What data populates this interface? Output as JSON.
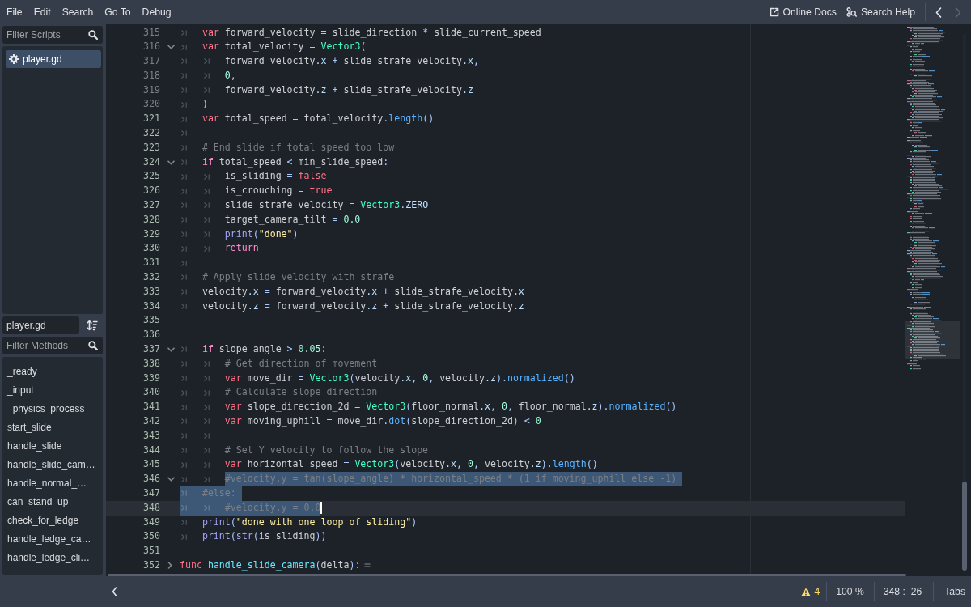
{
  "menu_bar": {
    "menus": [
      "File",
      "Edit",
      "Search",
      "Go To",
      "Debug"
    ],
    "links": [
      {
        "kind": "external",
        "label": "Online Docs"
      },
      {
        "kind": "help",
        "label": "Search Help"
      }
    ],
    "history": [
      {
        "kind": "back",
        "disabled": false
      },
      {
        "kind": "forward",
        "disabled": true
      }
    ]
  },
  "scripts_panel": {
    "filter": {
      "placeholder": "Filter Scripts"
    },
    "items": [
      {
        "label": "player.gd",
        "selected": true
      }
    ]
  },
  "methods_panel": {
    "script_name": "player.gd",
    "filter": {
      "placeholder": "Filter Methods"
    },
    "items": [
      {
        "label": "_ready",
        "selected": false
      },
      {
        "label": "_input",
        "selected": false
      },
      {
        "label": "_physics_process",
        "selected": false
      },
      {
        "label": "start_slide",
        "selected": false
      },
      {
        "label": "handle_slide",
        "selected": false
      },
      {
        "label": "handle_slide_cam…",
        "selected": false
      },
      {
        "label": "handle_normal_…",
        "selected": false
      },
      {
        "label": "can_stand_up",
        "selected": false
      },
      {
        "label": "check_for_ledge",
        "selected": false
      },
      {
        "label": "handle_ledge_ca…",
        "selected": false
      },
      {
        "label": "handle_ledge_cli…",
        "selected": false
      }
    ]
  },
  "editor": {
    "lines": [
      {
        "number": "315",
        "type_safe": false,
        "current": false,
        "tokens": [
          {
            "kind": "tab"
          },
          {
            "kind": "keyword",
            "text": "var"
          },
          {
            "kind": "plain",
            "text": " forward_velocity"
          },
          {
            "kind": "symbol",
            "text": " = "
          },
          {
            "kind": "plain",
            "text": "slide_direction"
          },
          {
            "kind": "symbol",
            "text": " * "
          },
          {
            "kind": "plain",
            "text": "slide_current_speed"
          }
        ]
      },
      {
        "number": "316",
        "type_safe": false,
        "current": false,
        "expanded": true,
        "tokens": [
          {
            "kind": "tab"
          },
          {
            "kind": "keyword",
            "text": "var"
          },
          {
            "kind": "plain",
            "text": " total_velocity"
          },
          {
            "kind": "symbol",
            "text": " = "
          },
          {
            "kind": "type",
            "text": "Vector3"
          },
          {
            "kind": "symbol",
            "text": "("
          }
        ]
      },
      {
        "number": "317",
        "type_safe": false,
        "current": false,
        "tokens": [
          {
            "kind": "tab"
          },
          {
            "kind": "tab"
          },
          {
            "kind": "plain",
            "text": "forward_velocity"
          },
          {
            "kind": "member",
            "text": ".x"
          },
          {
            "kind": "symbol",
            "text": " + "
          },
          {
            "kind": "plain",
            "text": "slide_strafe_velocity"
          },
          {
            "kind": "member",
            "text": ".x"
          },
          {
            "kind": "symbol",
            "text": ","
          }
        ]
      },
      {
        "number": "318",
        "type_safe": false,
        "current": false,
        "tokens": [
          {
            "kind": "tab"
          },
          {
            "kind": "tab"
          },
          {
            "kind": "number",
            "text": "0"
          },
          {
            "kind": "symbol",
            "text": ","
          }
        ]
      },
      {
        "number": "319",
        "type_safe": false,
        "current": false,
        "tokens": [
          {
            "kind": "tab"
          },
          {
            "kind": "tab"
          },
          {
            "kind": "plain",
            "text": "forward_velocity"
          },
          {
            "kind": "member",
            "text": ".z"
          },
          {
            "kind": "symbol",
            "text": " + "
          },
          {
            "kind": "plain",
            "text": "slide_strafe_velocity"
          },
          {
            "kind": "member",
            "text": ".z"
          }
        ]
      },
      {
        "number": "320",
        "type_safe": false,
        "current": false,
        "tokens": [
          {
            "kind": "tab"
          },
          {
            "kind": "symbol",
            "text": ")"
          }
        ]
      },
      {
        "number": "321",
        "type_safe": true,
        "current": false,
        "tokens": [
          {
            "kind": "tab"
          },
          {
            "kind": "keyword",
            "text": "var"
          },
          {
            "kind": "plain",
            "text": " total_speed"
          },
          {
            "kind": "symbol",
            "text": " = "
          },
          {
            "kind": "plain",
            "text": "total_velocity"
          },
          {
            "kind": "symbol",
            "text": "."
          },
          {
            "kind": "method",
            "text": "length"
          },
          {
            "kind": "symbol",
            "text": "()"
          }
        ]
      },
      {
        "number": "322",
        "type_safe": true,
        "current": false,
        "tokens": [
          {
            "kind": "tab"
          }
        ]
      },
      {
        "number": "323",
        "type_safe": true,
        "current": false,
        "tokens": [
          {
            "kind": "tab"
          },
          {
            "kind": "comment",
            "text": "# End slide if total speed too low"
          }
        ]
      },
      {
        "number": "324",
        "type_safe": true,
        "current": false,
        "expanded": true,
        "tokens": [
          {
            "kind": "tab"
          },
          {
            "kind": "control",
            "text": "if"
          },
          {
            "kind": "plain",
            "text": " total_speed"
          },
          {
            "kind": "symbol",
            "text": " < "
          },
          {
            "kind": "plain",
            "text": "min_slide_speed"
          },
          {
            "kind": "symbol",
            "text": ":"
          }
        ]
      },
      {
        "number": "325",
        "type_safe": true,
        "current": false,
        "tokens": [
          {
            "kind": "tab"
          },
          {
            "kind": "tab"
          },
          {
            "kind": "plain",
            "text": "is_sliding"
          },
          {
            "kind": "symbol",
            "text": " = "
          },
          {
            "kind": "keyword",
            "text": "false"
          }
        ]
      },
      {
        "number": "326",
        "type_safe": true,
        "current": false,
        "tokens": [
          {
            "kind": "tab"
          },
          {
            "kind": "tab"
          },
          {
            "kind": "plain",
            "text": "is_crouching"
          },
          {
            "kind": "symbol",
            "text": " = "
          },
          {
            "kind": "keyword",
            "text": "true"
          }
        ]
      },
      {
        "number": "327",
        "type_safe": true,
        "current": false,
        "tokens": [
          {
            "kind": "tab"
          },
          {
            "kind": "tab"
          },
          {
            "kind": "plain",
            "text": "slide_strafe_velocity"
          },
          {
            "kind": "symbol",
            "text": " = "
          },
          {
            "kind": "type",
            "text": "Vector3"
          },
          {
            "kind": "symbol",
            "text": "."
          },
          {
            "kind": "member",
            "text": "ZERO"
          }
        ]
      },
      {
        "number": "328",
        "type_safe": true,
        "current": false,
        "tokens": [
          {
            "kind": "tab"
          },
          {
            "kind": "tab"
          },
          {
            "kind": "plain",
            "text": "target_camera_tilt"
          },
          {
            "kind": "symbol",
            "text": " = "
          },
          {
            "kind": "number",
            "text": "0.0"
          }
        ]
      },
      {
        "number": "329",
        "type_safe": true,
        "current": false,
        "tokens": [
          {
            "kind": "tab"
          },
          {
            "kind": "tab"
          },
          {
            "kind": "builtin",
            "text": "print"
          },
          {
            "kind": "symbol",
            "text": "("
          },
          {
            "kind": "string",
            "text": "\"done\""
          },
          {
            "kind": "symbol",
            "text": ")"
          }
        ]
      },
      {
        "number": "330",
        "type_safe": true,
        "current": false,
        "tokens": [
          {
            "kind": "tab"
          },
          {
            "kind": "tab"
          },
          {
            "kind": "control",
            "text": "return"
          }
        ]
      },
      {
        "number": "331",
        "type_safe": true,
        "current": false,
        "tokens": [
          {
            "kind": "tab"
          }
        ]
      },
      {
        "number": "332",
        "type_safe": true,
        "current": false,
        "tokens": [
          {
            "kind": "tab"
          },
          {
            "kind": "comment",
            "text": "# Apply slide velocity with strafe"
          }
        ]
      },
      {
        "number": "333",
        "type_safe": true,
        "current": false,
        "tokens": [
          {
            "kind": "tab"
          },
          {
            "kind": "plain",
            "text": "velocity"
          },
          {
            "kind": "member",
            "text": ".x"
          },
          {
            "kind": "symbol",
            "text": " = "
          },
          {
            "kind": "plain",
            "text": "forward_velocity"
          },
          {
            "kind": "member",
            "text": ".x"
          },
          {
            "kind": "symbol",
            "text": " + "
          },
          {
            "kind": "plain",
            "text": "slide_strafe_velocity"
          },
          {
            "kind": "member",
            "text": ".x"
          }
        ]
      },
      {
        "number": "334",
        "type_safe": true,
        "current": false,
        "tokens": [
          {
            "kind": "tab"
          },
          {
            "kind": "plain",
            "text": "velocity"
          },
          {
            "kind": "member",
            "text": ".z"
          },
          {
            "kind": "symbol",
            "text": " = "
          },
          {
            "kind": "plain",
            "text": "forward_velocity"
          },
          {
            "kind": "member",
            "text": ".z"
          },
          {
            "kind": "symbol",
            "text": " + "
          },
          {
            "kind": "plain",
            "text": "slide_strafe_velocity"
          },
          {
            "kind": "member",
            "text": ".z"
          }
        ]
      },
      {
        "number": "335",
        "type_safe": true,
        "current": false
      },
      {
        "number": "336",
        "type_safe": true,
        "current": false
      },
      {
        "number": "337",
        "type_safe": true,
        "current": false,
        "expanded": true,
        "tokens": [
          {
            "kind": "tab"
          },
          {
            "kind": "control",
            "text": "if"
          },
          {
            "kind": "plain",
            "text": " slope_angle"
          },
          {
            "kind": "symbol",
            "text": " > "
          },
          {
            "kind": "number",
            "text": "0.05"
          },
          {
            "kind": "symbol",
            "text": ":"
          }
        ]
      },
      {
        "number": "338",
        "type_safe": true,
        "current": false,
        "tokens": [
          {
            "kind": "tab"
          },
          {
            "kind": "tab"
          },
          {
            "kind": "comment",
            "text": "# Get direction of movement"
          }
        ]
      },
      {
        "number": "339",
        "type_safe": true,
        "current": false,
        "tokens": [
          {
            "kind": "tab"
          },
          {
            "kind": "tab"
          },
          {
            "kind": "keyword",
            "text": "var"
          },
          {
            "kind": "plain",
            "text": " move_dir"
          },
          {
            "kind": "symbol",
            "text": " = "
          },
          {
            "kind": "type",
            "text": "Vector3"
          },
          {
            "kind": "symbol",
            "text": "("
          },
          {
            "kind": "plain",
            "text": "velocity"
          },
          {
            "kind": "member",
            "text": ".x"
          },
          {
            "kind": "symbol",
            "text": ", "
          },
          {
            "kind": "number",
            "text": "0"
          },
          {
            "kind": "symbol",
            "text": ", "
          },
          {
            "kind": "plain",
            "text": "velocity"
          },
          {
            "kind": "member",
            "text": ".z"
          },
          {
            "kind": "symbol",
            "text": ")."
          },
          {
            "kind": "method",
            "text": "normalized"
          },
          {
            "kind": "symbol",
            "text": "()"
          }
        ]
      },
      {
        "number": "340",
        "type_safe": true,
        "current": false,
        "tokens": [
          {
            "kind": "tab"
          },
          {
            "kind": "tab"
          },
          {
            "kind": "comment",
            "text": "# Calculate slope direction"
          }
        ]
      },
      {
        "number": "341",
        "type_safe": true,
        "current": false,
        "tokens": [
          {
            "kind": "tab"
          },
          {
            "kind": "tab"
          },
          {
            "kind": "keyword",
            "text": "var"
          },
          {
            "kind": "plain",
            "text": " slope_direction_2d"
          },
          {
            "kind": "symbol",
            "text": " = "
          },
          {
            "kind": "type",
            "text": "Vector3"
          },
          {
            "kind": "symbol",
            "text": "("
          },
          {
            "kind": "plain",
            "text": "floor_normal"
          },
          {
            "kind": "member",
            "text": ".x"
          },
          {
            "kind": "symbol",
            "text": ", "
          },
          {
            "kind": "number",
            "text": "0"
          },
          {
            "kind": "symbol",
            "text": ", "
          },
          {
            "kind": "plain",
            "text": "floor_normal"
          },
          {
            "kind": "member",
            "text": ".z"
          },
          {
            "kind": "symbol",
            "text": ")."
          },
          {
            "kind": "method",
            "text": "normalized"
          },
          {
            "kind": "symbol",
            "text": "()"
          }
        ]
      },
      {
        "number": "342",
        "type_safe": true,
        "current": false,
        "tokens": [
          {
            "kind": "tab"
          },
          {
            "kind": "tab"
          },
          {
            "kind": "keyword",
            "text": "var"
          },
          {
            "kind": "plain",
            "text": " moving_uphill"
          },
          {
            "kind": "symbol",
            "text": " = "
          },
          {
            "kind": "plain",
            "text": "move_dir"
          },
          {
            "kind": "symbol",
            "text": "."
          },
          {
            "kind": "method",
            "text": "dot"
          },
          {
            "kind": "symbol",
            "text": "("
          },
          {
            "kind": "plain",
            "text": "slope_direction_2d"
          },
          {
            "kind": "symbol",
            "text": ") < "
          },
          {
            "kind": "number",
            "text": "0"
          }
        ]
      },
      {
        "number": "343",
        "type_safe": true,
        "current": false,
        "tokens": [
          {
            "kind": "tab"
          },
          {
            "kind": "tab"
          }
        ]
      },
      {
        "number": "344",
        "type_safe": true,
        "current": false,
        "tokens": [
          {
            "kind": "tab"
          },
          {
            "kind": "tab"
          },
          {
            "kind": "comment",
            "text": "# Set Y velocity to follow the slope"
          }
        ]
      },
      {
        "number": "345",
        "type_safe": true,
        "current": false,
        "tokens": [
          {
            "kind": "tab"
          },
          {
            "kind": "tab"
          },
          {
            "kind": "keyword",
            "text": "var"
          },
          {
            "kind": "plain",
            "text": " horizontal_speed"
          },
          {
            "kind": "symbol",
            "text": " = "
          },
          {
            "kind": "type",
            "text": "Vector3"
          },
          {
            "kind": "symbol",
            "text": "("
          },
          {
            "kind": "plain",
            "text": "velocity"
          },
          {
            "kind": "member",
            "text": ".x"
          },
          {
            "kind": "symbol",
            "text": ", "
          },
          {
            "kind": "number",
            "text": "0"
          },
          {
            "kind": "symbol",
            "text": ", "
          },
          {
            "kind": "plain",
            "text": "velocity"
          },
          {
            "kind": "member",
            "text": ".z"
          },
          {
            "kind": "symbol",
            "text": ")."
          },
          {
            "kind": "method",
            "text": "length"
          },
          {
            "kind": "symbol",
            "text": "()"
          }
        ]
      },
      {
        "number": "346",
        "type_safe": true,
        "current": false,
        "expanded": true,
        "tokens": [
          {
            "kind": "tab",
            "selected": false
          },
          {
            "kind": "tab",
            "selected": false
          },
          {
            "kind": "comment",
            "text": "#velocity.y = tan(slope_angle) * horizontal_speed * (1 if moving_uphill else -1)",
            "selected": true
          }
        ]
      },
      {
        "number": "347",
        "type_safe": true,
        "current": false,
        "tokens": [
          {
            "kind": "tab",
            "selected": true
          },
          {
            "kind": "comment",
            "text": "#else:",
            "selected": true
          }
        ]
      },
      {
        "number": "348",
        "type_safe": true,
        "current": true,
        "tokens": [
          {
            "kind": "tab",
            "selected": true
          },
          {
            "kind": "tab",
            "selected": true
          },
          {
            "kind": "comment",
            "text": "#velocity.y = 0.0",
            "selected": true
          }
        ]
      },
      {
        "number": "349",
        "type_safe": true,
        "current": false,
        "tokens": [
          {
            "kind": "tab"
          },
          {
            "kind": "builtin",
            "text": "print"
          },
          {
            "kind": "symbol",
            "text": "("
          },
          {
            "kind": "string",
            "text": "\"done with one loop of sliding\""
          },
          {
            "kind": "symbol",
            "text": ")"
          }
        ]
      },
      {
        "number": "350",
        "type_safe": true,
        "current": false,
        "tokens": [
          {
            "kind": "tab"
          },
          {
            "kind": "builtin",
            "text": "print"
          },
          {
            "kind": "symbol",
            "text": "("
          },
          {
            "kind": "builtin",
            "text": "str"
          },
          {
            "kind": "symbol",
            "text": "("
          },
          {
            "kind": "plain",
            "text": "is_sliding"
          },
          {
            "kind": "symbol",
            "text": "))"
          }
        ]
      },
      {
        "number": "351",
        "type_safe": true,
        "current": false
      },
      {
        "number": "352",
        "type_safe": true,
        "current": false,
        "expanded": false,
        "tokens": [
          {
            "kind": "keyword",
            "text": "func"
          },
          {
            "kind": "definition",
            "text": " handle_slide_camera"
          },
          {
            "kind": "symbol",
            "text": "("
          },
          {
            "kind": "plain",
            "text": "delta"
          },
          {
            "kind": "symbol",
            "text": "):"
          }
        ]
      }
    ]
  },
  "status_bar": {
    "warnings": "4",
    "zoom": "100 %",
    "cursor": "348 :  26",
    "indentation": "Tabs"
  }
}
